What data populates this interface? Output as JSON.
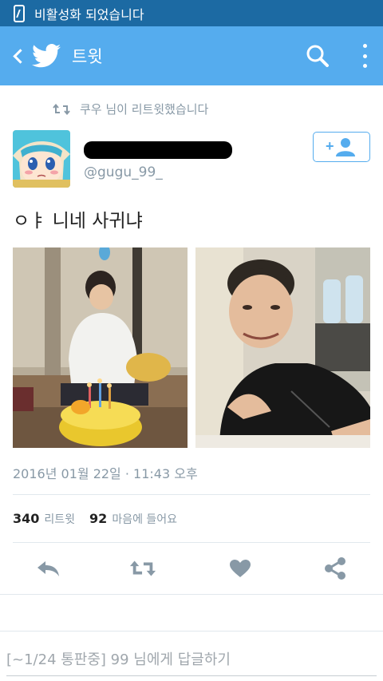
{
  "status_bar": {
    "message": "비활성화 되었습니다",
    "icon": "phone-rotate-icon"
  },
  "app_bar": {
    "title": "트윗",
    "back_icon": "back-arrow-icon",
    "logo": "twitter-bird-icon",
    "search_icon": "search-icon",
    "more_icon": "more-vert-icon"
  },
  "retweet_context": {
    "text": "쿠우 님이 리트윗했습니다",
    "icon": "retweet-icon"
  },
  "author": {
    "handle": "@gugu_99_",
    "name_redacted": true,
    "avatar": "anime-avatar"
  },
  "follow_button": {
    "icon": "add-user-icon",
    "label": "+"
  },
  "tweet": {
    "text": "ㅇㅑ 니네 사귀냐",
    "photos": [
      "birthday-cake-photo",
      "smiling-man-photo"
    ],
    "timestamp": "2016년 01월 22일 · 11:43 오후"
  },
  "stats": {
    "retweets_count": "340",
    "retweets_label": "리트윗",
    "likes_count": "92",
    "likes_label": "마음에 들어요"
  },
  "actions": [
    "reply-icon",
    "retweet-icon",
    "like-heart-icon",
    "share-icon"
  ],
  "reply": {
    "placeholder": "[~1/24 통판중] 99 님에게 답글하기"
  },
  "colors": {
    "status_bar": "#1c6aa3",
    "app_bar": "#55acee",
    "secondary_text": "#8899a6",
    "icon_gray": "#8899a6"
  }
}
